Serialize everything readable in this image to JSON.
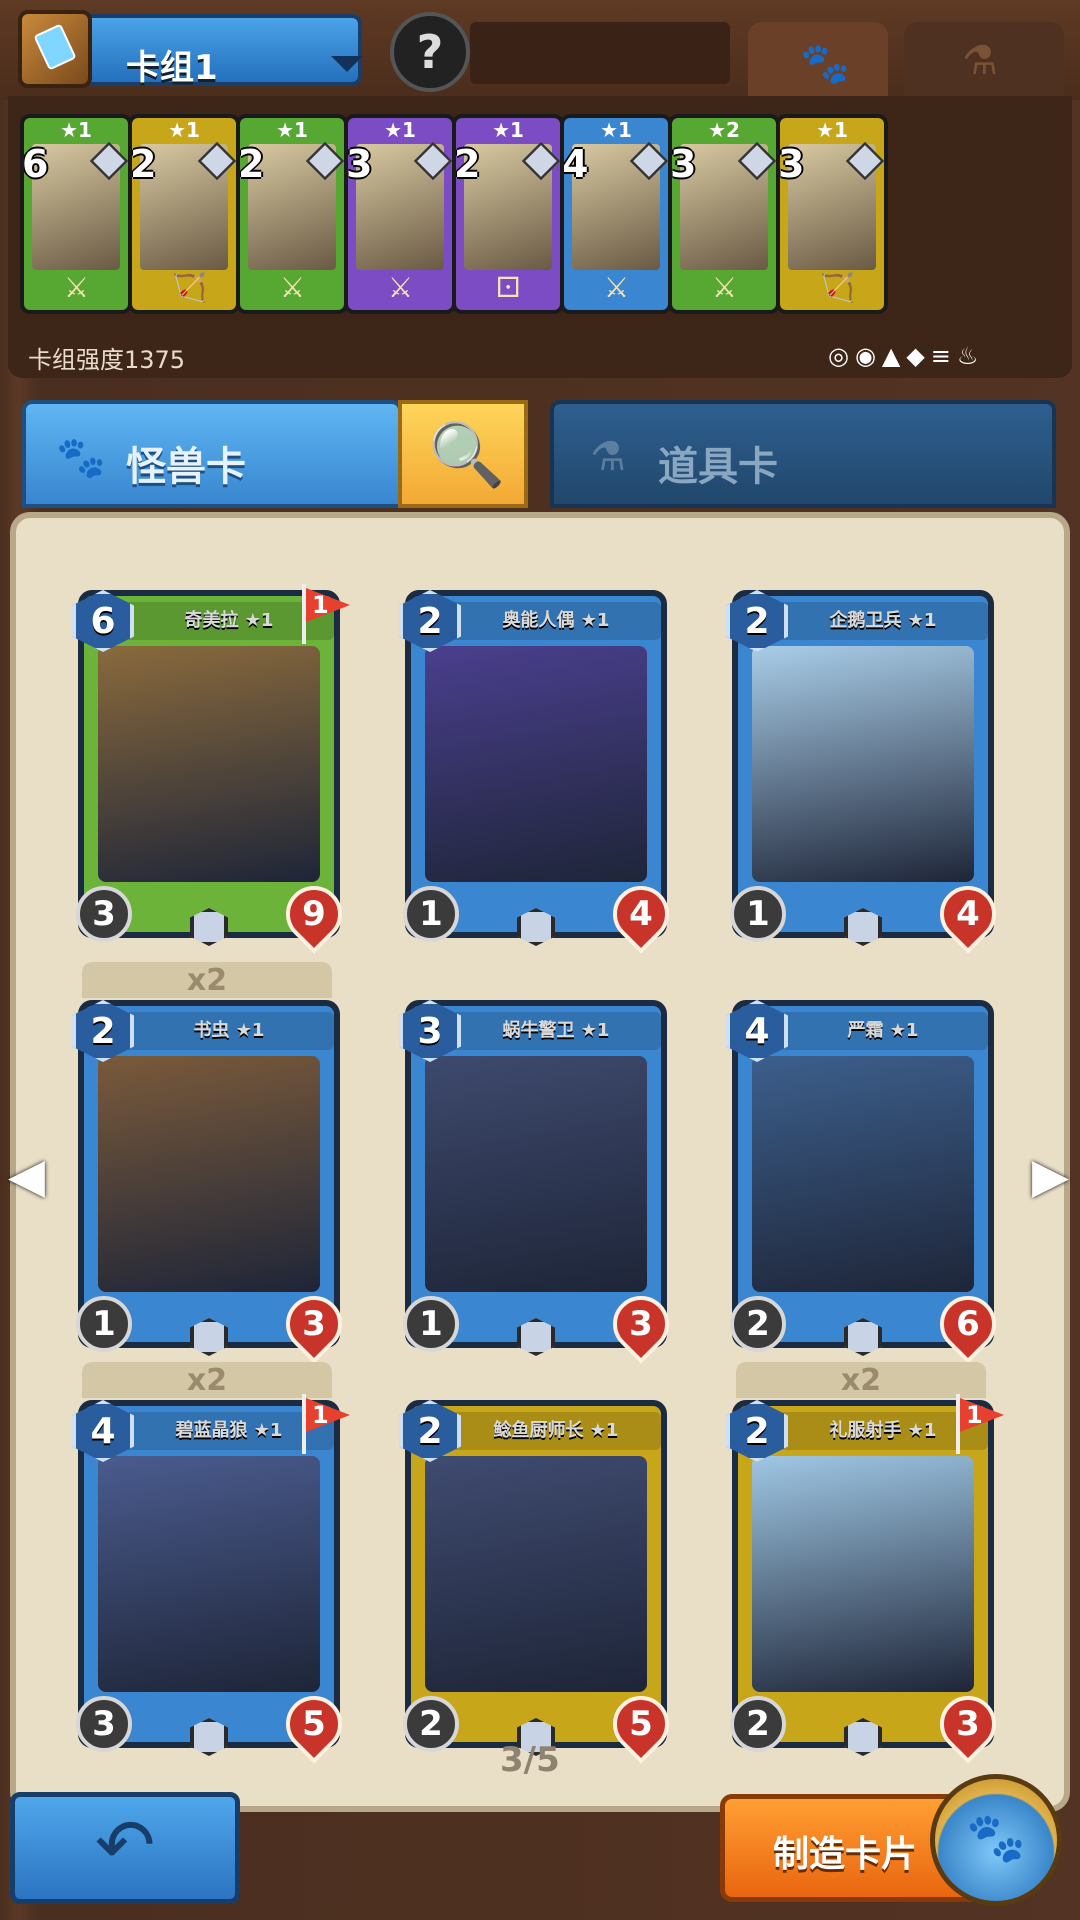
{
  "header": {
    "deck_name": "卡组1",
    "avatar_glyph": "?",
    "tabs": [
      {
        "icon": "paw-icon",
        "active": true
      },
      {
        "icon": "flask-icon",
        "active": false
      }
    ]
  },
  "deck_strip": {
    "cards": [
      {
        "stars": "★1",
        "cost": "6",
        "color": "#57a832",
        "weapon": "⚔"
      },
      {
        "stars": "★1",
        "cost": "2",
        "color": "#c8a61a",
        "weapon": "🏹"
      },
      {
        "stars": "★1",
        "cost": "2",
        "color": "#57a832",
        "weapon": "⚔"
      },
      {
        "stars": "★1",
        "cost": "3",
        "color": "#7b4cc4",
        "weapon": "⚔"
      },
      {
        "stars": "★1",
        "cost": "2",
        "color": "#7b4cc4",
        "weapon": "⚀"
      },
      {
        "stars": "★1",
        "cost": "4",
        "color": "#3a86d0",
        "weapon": "⚔"
      },
      {
        "stars": "★2",
        "cost": "3",
        "color": "#57a832",
        "weapon": "⚔"
      },
      {
        "stars": "★1",
        "cost": "3",
        "color": "#c8a61a",
        "weapon": "🏹"
      }
    ],
    "deck_power": "卡组强度1375",
    "factions": "◎◉▲◆≡♨"
  },
  "category_tabs": {
    "monster_label": "怪兽卡",
    "item_label": "道具卡"
  },
  "cards": [
    {
      "name": "奇美拉 ★1",
      "cost": "6",
      "attack": "3",
      "hp": "9",
      "frame": "#6cb33a",
      "art": "#8a6a3c",
      "flag": "1",
      "multiplier": ""
    },
    {
      "name": "奥能人偶 ★1",
      "cost": "2",
      "attack": "1",
      "hp": "4",
      "frame": "#3b86d0",
      "art": "#4a3f8e",
      "flag": "",
      "multiplier": ""
    },
    {
      "name": "企鹅卫兵 ★1",
      "cost": "2",
      "attack": "1",
      "hp": "4",
      "frame": "#3b86d0",
      "art": "#a9cde8",
      "flag": "",
      "multiplier": ""
    },
    {
      "name": "书虫 ★1",
      "cost": "2",
      "attack": "1",
      "hp": "3",
      "frame": "#3b86d0",
      "art": "#7a5a3a",
      "flag": "",
      "multiplier": "x2"
    },
    {
      "name": "蜗牛警卫 ★1",
      "cost": "3",
      "attack": "1",
      "hp": "3",
      "frame": "#3b86d0",
      "art": "#3e4a6e",
      "flag": "",
      "multiplier": ""
    },
    {
      "name": "严霜 ★1",
      "cost": "4",
      "attack": "2",
      "hp": "6",
      "frame": "#3b86d0",
      "art": "#3c5f8c",
      "flag": "",
      "multiplier": ""
    },
    {
      "name": "碧蓝晶狼 ★1",
      "cost": "4",
      "attack": "3",
      "hp": "5",
      "frame": "#3b86d0",
      "art": "#4a5b8e",
      "flag": "1",
      "multiplier": "x2"
    },
    {
      "name": "鲶鱼厨师长 ★1",
      "cost": "2",
      "attack": "2",
      "hp": "5",
      "frame": "#c8a61a",
      "art": "#3f4b70",
      "flag": "",
      "multiplier": ""
    },
    {
      "name": "礼服射手 ★1",
      "cost": "2",
      "attack": "2",
      "hp": "3",
      "frame": "#c8a61a",
      "art": "#9fc7e4",
      "flag": "1",
      "multiplier": "x2"
    }
  ],
  "pagination": "3/5",
  "footer": {
    "craft_label": "制造卡片"
  }
}
